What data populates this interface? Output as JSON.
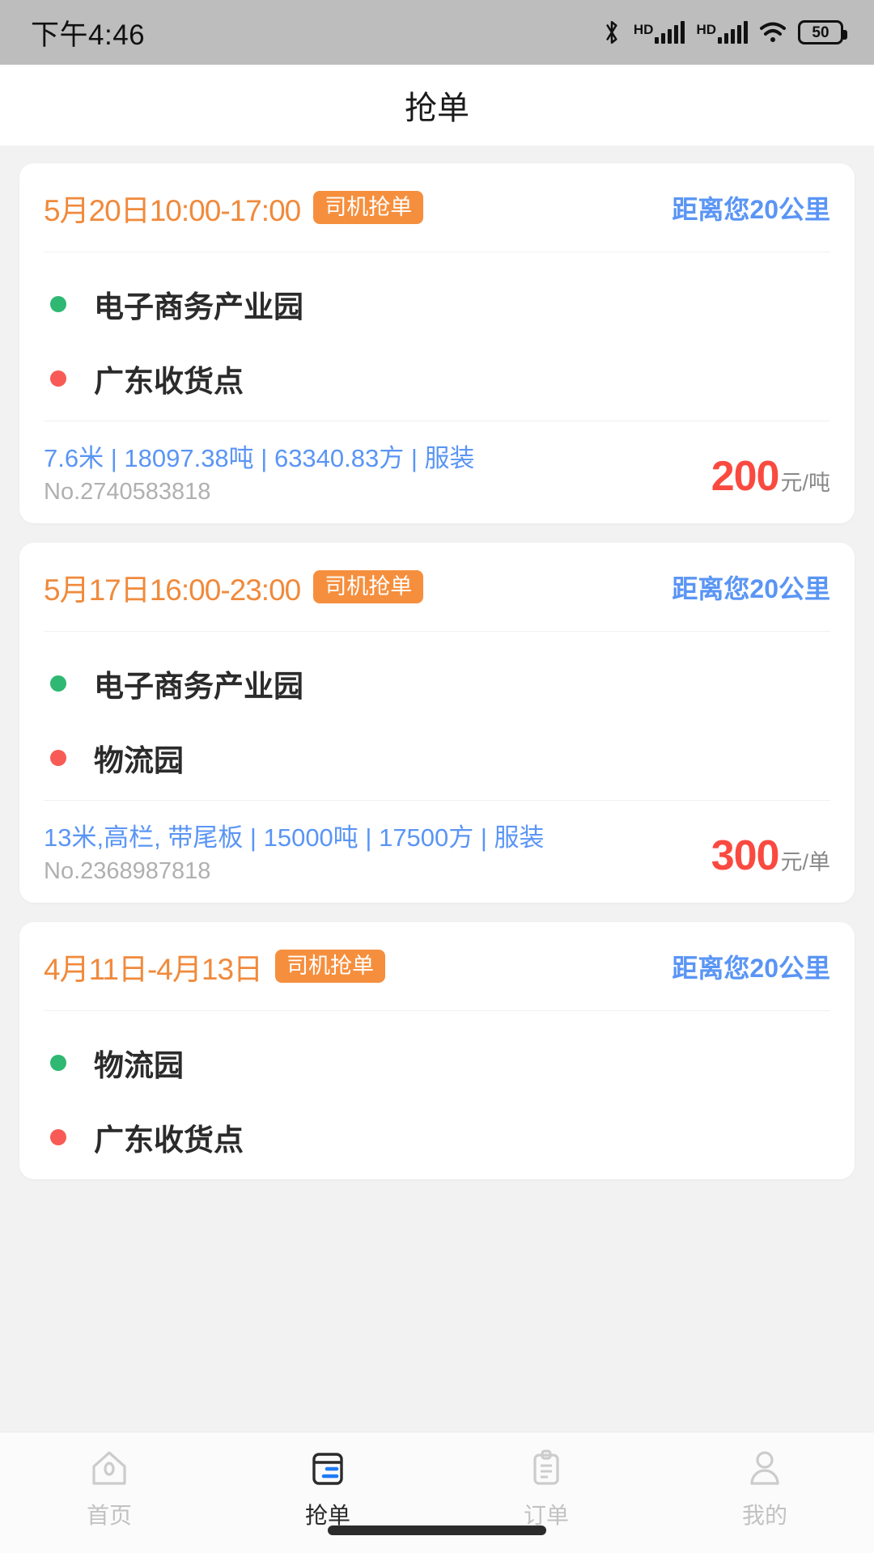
{
  "status_bar": {
    "time": "下午4:46",
    "bluetooth_icon": "bluetooth-icon",
    "hd_label_1": "HD",
    "hd_label_2": "HD",
    "wifi_icon": "wifi-icon",
    "battery_level": "50"
  },
  "header": {
    "title": "抢单"
  },
  "orders": [
    {
      "date": "5月20日10:00-17:00",
      "badge": "司机抢单",
      "distance": "距离您20公里",
      "origin": "电子商务产业园",
      "destination": "广东收货点",
      "spec": "7.6米 | 18097.38吨 | 63340.83方 | 服装",
      "order_no": "No.2740583818",
      "price": "200",
      "price_unit": "元/吨"
    },
    {
      "date": "5月17日16:00-23:00",
      "badge": "司机抢单",
      "distance": "距离您20公里",
      "origin": "电子商务产业园",
      "destination": "物流园",
      "spec": "13米,高栏, 带尾板 | 15000吨 | 17500方 | 服装",
      "order_no": "No.2368987818",
      "price": "300",
      "price_unit": "元/单"
    },
    {
      "date": "4月11日-4月13日",
      "badge": "司机抢单",
      "distance": "距离您20公里",
      "origin": "物流园",
      "destination": "广东收货点",
      "spec": "",
      "order_no": "",
      "price": "",
      "price_unit": ""
    }
  ],
  "tabbar": {
    "items": [
      {
        "label": "首页",
        "icon": "home-icon",
        "active": false
      },
      {
        "label": "抢单",
        "icon": "inbox-icon",
        "active": true
      },
      {
        "label": "订单",
        "icon": "clipboard-icon",
        "active": false
      },
      {
        "label": "我的",
        "icon": "person-icon",
        "active": false
      }
    ]
  },
  "colors": {
    "accent_orange": "#f58f3e",
    "link_blue": "#5a95f5",
    "price_red": "#fa4a40",
    "origin_green": "#2eb872",
    "destination_red": "#f85b55",
    "page_bg": "#f2f2f2"
  }
}
